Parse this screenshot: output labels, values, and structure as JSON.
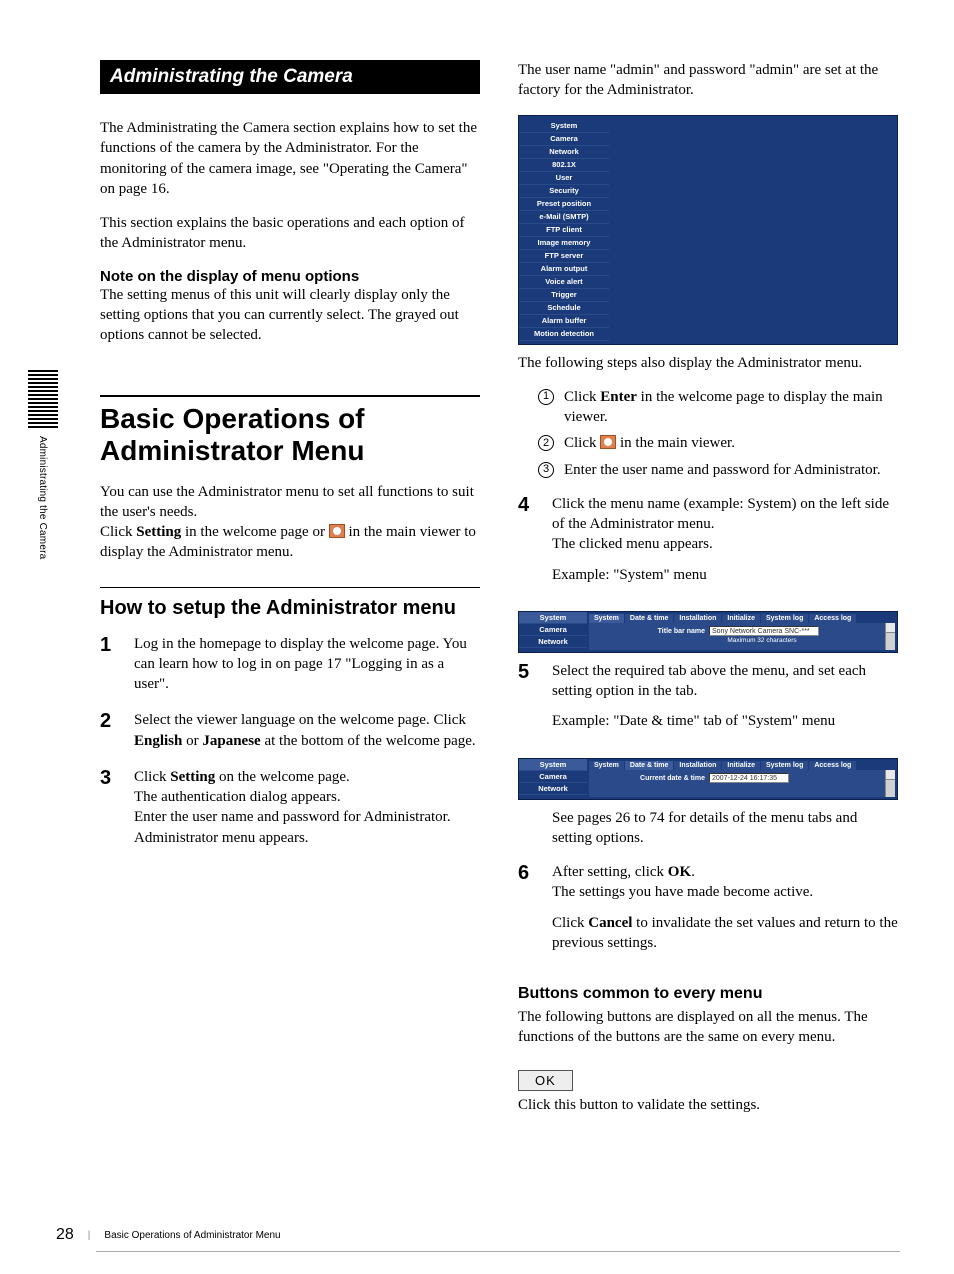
{
  "sideTab": "Administrating the Camera",
  "header": "Administrating the Camera",
  "intro1": "The Administrating the Camera section explains how to set the functions of the camera by the Administrator. For the monitoring of the camera image, see \"Operating the Camera\" on page 16.",
  "intro2": "This section explains the basic operations and each option of the Administrator menu.",
  "noteHeading": "Note on the display of menu options",
  "noteBody": "The setting menus of this unit will clearly display only the setting options that you can currently select. The grayed out options cannot be selected.",
  "mainTitle": "Basic Operations of Administrator Menu",
  "mainIntro_a": "You can use the Administrator menu to set all functions to suit the user's needs.",
  "mainIntro_b1": "Click ",
  "mainIntro_b_bold": "Setting",
  "mainIntro_b2": " in the welcome page or ",
  "mainIntro_b3": " in the main viewer to display the Administrator menu.",
  "subTitle": "How to setup the Administrator menu",
  "steps_left": [
    {
      "n": "1",
      "html": "Log in the homepage to display the welcome page. You can learn how to log in on page 17 \"Logging in as a user\"."
    },
    {
      "n": "2",
      "html": "Select the viewer language on the welcome page. Click <strong>English</strong> or <strong>Japanese</strong> at the bottom of the welcome page."
    },
    {
      "n": "3",
      "html": "Click <strong>Setting</strong> on the welcome page.<br>The authentication dialog appears.<br>Enter the user name and password for Administrator. Administrator menu appears."
    }
  ],
  "rightTop": "The user name \"admin\" and password \"admin\" are set at the factory for the Administrator.",
  "adminMenu": [
    "System",
    "Camera",
    "Network",
    "802.1X",
    "User",
    "Security",
    "Preset position",
    "e-Mail (SMTP)",
    "FTP client",
    "Image memory",
    "FTP server",
    "Alarm output",
    "Voice alert",
    "Trigger",
    "Schedule",
    "Alarm buffer",
    "Motion detection"
  ],
  "afterShot": "The following steps also display the Administrator menu.",
  "sub1a": "Click ",
  "sub1b": "Enter",
  "sub1c": " in the welcome page to display the main viewer.",
  "sub2a": "Click ",
  "sub2b": " in the main viewer.",
  "sub3": "Enter the user name and password for Administrator.",
  "step4a": "Click the menu name (example: System) on the left side of the Administrator menu.",
  "step4b": "The clicked menu appears.",
  "step4c": "Example: \"System\" menu",
  "shot2": {
    "side": [
      "System",
      "Camera",
      "Network"
    ],
    "tabs": [
      "System",
      "Date & time",
      "Installation",
      "Initialize",
      "System log",
      "Access log"
    ],
    "fieldLabel": "Title bar name",
    "fieldValue": "Sony Network Camera SNC-***",
    "hint": "Maximum 32 characters"
  },
  "step5a": "Select the required tab above the menu, and set each setting option in the tab.",
  "step5b": "Example: \"Date & time\" tab of \"System\" menu",
  "shot3": {
    "side": [
      "System",
      "Camera",
      "Network"
    ],
    "tabs": [
      "System",
      "Date & time",
      "Installation",
      "Initialize",
      "System log",
      "Access log"
    ],
    "fieldLabel": "Current date & time",
    "fieldValue": "2007-12-24 16:17:35"
  },
  "step5c": "See pages 26 to 74 for details of the menu tabs and setting options.",
  "step6a": "After setting, click ",
  "step6b": "OK",
  "step6c": ".",
  "step6d": "The settings you have made become active.",
  "step6e": "Click ",
  "step6f": "Cancel",
  "step6g": " to invalidate the set values and return to the previous settings.",
  "buttonsHeading": "Buttons common to every menu",
  "buttonsBody": "The following buttons are displayed on all the menus. The functions of the buttons are the same on every menu.",
  "okLabel": "OK",
  "okDesc": "Click this button to validate the settings.",
  "pageNum": "28",
  "footerText": "Basic Operations of Administrator Menu"
}
